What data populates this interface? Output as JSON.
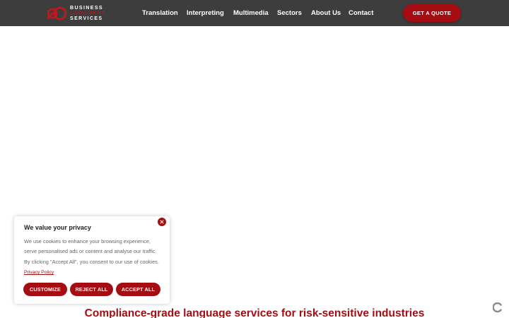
{
  "header": {
    "logo": {
      "line1": "BUSINESS",
      "line2": "LANGUAGE",
      "line3": "SERVICES",
      "icon": "bls-logo-icon"
    },
    "nav": [
      {
        "label": "Translation"
      },
      {
        "label": "Interpreting"
      },
      {
        "label": "Multimedia"
      },
      {
        "label": "Sectors"
      },
      {
        "label": "About Us"
      },
      {
        "label": "Contact"
      }
    ],
    "cta_label": "GET A QUOTE"
  },
  "cookie_banner": {
    "title": "We value your privacy",
    "body": "We use cookies to enhance your browsing experience, serve personalised ads or content and analyse our traffic. By clicking \"Accept All\", you consent to our use of cookies.",
    "privacy_link": "Privacy Policy",
    "buttons": {
      "customize": "CUSTOMIZE",
      "reject": "REJECT ALL",
      "accept": "ACCEPT ALL"
    },
    "close_icon": "close-icon"
  },
  "main": {
    "headline": "Compliance-grade language services for risk-sensitive industries"
  },
  "colors": {
    "nav_bg": "#3d3d3d",
    "brand_red": "#a50d13",
    "white": "#ffffff"
  }
}
